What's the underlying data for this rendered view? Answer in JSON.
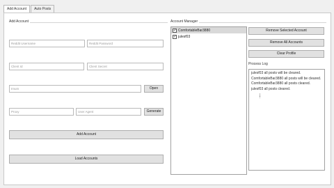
{
  "tabs": [
    {
      "label": "Add Account",
      "active": true
    },
    {
      "label": "Auto Posts",
      "active": false
    }
  ],
  "add_account": {
    "group_title": "Add Account",
    "reddit_username_placeholder": "Reddit Username",
    "reddit_password_placeholder": "Reddit Password",
    "client_id_placeholder": "Client Id",
    "client_secret_placeholder": "Client Secret",
    "imum_placeholder": "Imum",
    "open_label": "Open",
    "proxy_placeholder": "Proxy",
    "user_agent_placeholder": "User Agent",
    "generate_label": "Generate",
    "add_account_label": "Add Account",
    "load_accounts_label": "Load Accounts"
  },
  "account_manager": {
    "group_title": "Account Manager",
    "accounts": [
      {
        "name": "ComfortableBar3880",
        "checked": true,
        "selected": true
      },
      {
        "name": "julesf03",
        "checked": true,
        "selected": false
      }
    ],
    "remove_selected_label": "Remove Selected Account",
    "remove_all_label": "Remove All Accounts",
    "clear_profile_label": "Clear Profile",
    "process_log_title": "Process Log",
    "log_lines": [
      "julesf03 all posts will be cleared.",
      "ComfortableBar3880 all posts will be cleared.",
      "ComfortableBar3880 all posts cleared.",
      "julesf03 all posts cleared."
    ]
  },
  "colors": {
    "panel_bg": "#ffffff",
    "window_bg": "#f0f0f0",
    "button_bg": "#e1e1e1",
    "selection_bg": "#d9d9d9"
  }
}
